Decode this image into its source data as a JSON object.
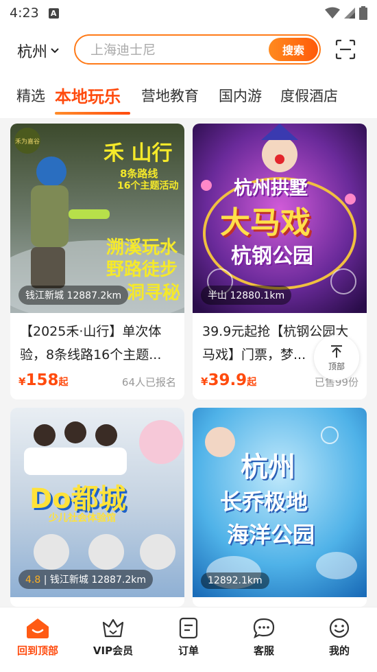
{
  "status_bar": {
    "time": "4:23",
    "notification_glyph": "A"
  },
  "header": {
    "city": "杭州",
    "search_placeholder": "上海迪士尼",
    "search_button": "搜索"
  },
  "tabs": [
    {
      "label": "精选",
      "active": false
    },
    {
      "label": "本地玩乐",
      "active": true
    },
    {
      "label": "营地教育",
      "active": false
    },
    {
      "label": "国内游",
      "active": false
    },
    {
      "label": "度假酒店",
      "active": false
    }
  ],
  "cards": [
    {
      "image_text": {
        "line1": "禾 山行",
        "line2": "8条路线",
        "line3": "16个主题活动",
        "line4": "溯溪玩水",
        "line5": "野路徒步",
        "line6": "洞寻秘",
        "logo": "禾为嘉谷"
      },
      "location": "钱江新城 12887.2km",
      "title": "【2025禾·山行】单次体验，8条线路16个主题...",
      "price_symbol": "¥",
      "price": "158",
      "price_suffix": "起",
      "sold": "64人已报名"
    },
    {
      "image_text": {
        "line1": "杭州拱墅",
        "line2": "大马戏",
        "line3": "杭钢公园"
      },
      "location": "半山 12880.1km",
      "title": "39.9元起抢【杭钢公园大马戏】门票，梦...",
      "price_symbol": "¥",
      "price": "39.9",
      "price_suffix": "起",
      "sold": "已售99份"
    },
    {
      "image_text": {
        "line1": "Do都城",
        "line2": "少儿社会体验馆"
      },
      "rating": "4.8",
      "location": "钱江新城 12887.2km",
      "title": "",
      "price": "",
      "sold": ""
    },
    {
      "image_text": {
        "line1": "杭州",
        "line2": "长乔极地",
        "line3": "海洋公园"
      },
      "location": "12892.1km",
      "title": "",
      "price": "",
      "sold": ""
    }
  ],
  "back_to_top": {
    "label": "顶部",
    "icon": "arrow-up-icon"
  },
  "bottom_nav": [
    {
      "label": "回到顶部",
      "icon": "home-icon",
      "active": true
    },
    {
      "label": "VIP会员",
      "icon": "vip-crown-icon",
      "active": false
    },
    {
      "label": "订单",
      "icon": "order-icon",
      "active": false
    },
    {
      "label": "客服",
      "icon": "chat-icon",
      "active": false
    },
    {
      "label": "我的",
      "icon": "profile-icon",
      "active": false
    }
  ],
  "colors": {
    "accent": "#ff4b0e",
    "accent_light": "#ff8a1f",
    "muted": "#999999"
  }
}
